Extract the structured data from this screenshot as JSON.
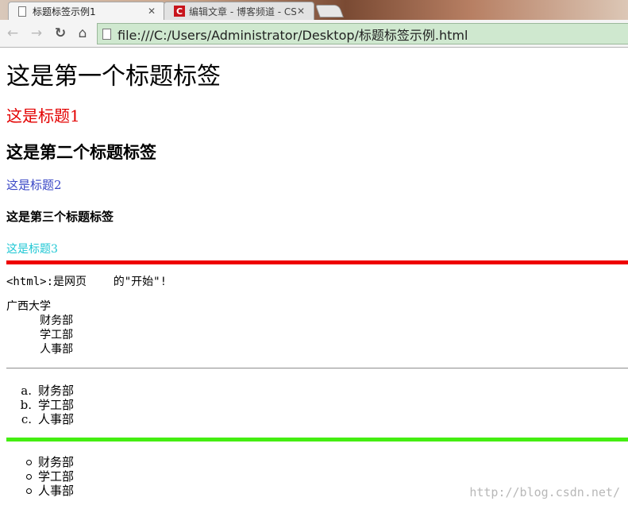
{
  "browser": {
    "tabs": [
      {
        "title": "标题标签示例1",
        "close": "✕"
      },
      {
        "title": "编辑文章 - 博客频道 - CSI",
        "close": "✕"
      }
    ],
    "csdn_icon_letter": "C",
    "nav": {
      "back": "←",
      "forward": "→",
      "reload": "↻",
      "home": "⌂"
    },
    "url": "file:///C:/Users/Administrator/Desktop/标题标签示例.html"
  },
  "page": {
    "h1": "这是第一个标题标签",
    "sub1": "这是标题1",
    "h2": "这是第二个标题标签",
    "sub2": "这是标题2",
    "h3": "这是第三个标题标签",
    "sub3": "这是标题3",
    "pre_line": "<html>:是网页    的\"开始\"!",
    "pre_block": "广西大学\n     财务部\n     学工部\n     人事部",
    "ordered_list": [
      {
        "marker": "a.",
        "text": "财务部"
      },
      {
        "marker": "b.",
        "text": "学工部"
      },
      {
        "marker": "c.",
        "text": "人事部"
      }
    ],
    "unordered_list": [
      "财务部",
      "学工部",
      "人事部"
    ],
    "watermark": "http://blog.csdn.net/"
  },
  "colors": {
    "sub1": "#e30000",
    "sub2": "#3a47c6",
    "sub3": "#1fc7d4",
    "hr_red": "#ee0000",
    "hr_green": "#44ee11"
  }
}
